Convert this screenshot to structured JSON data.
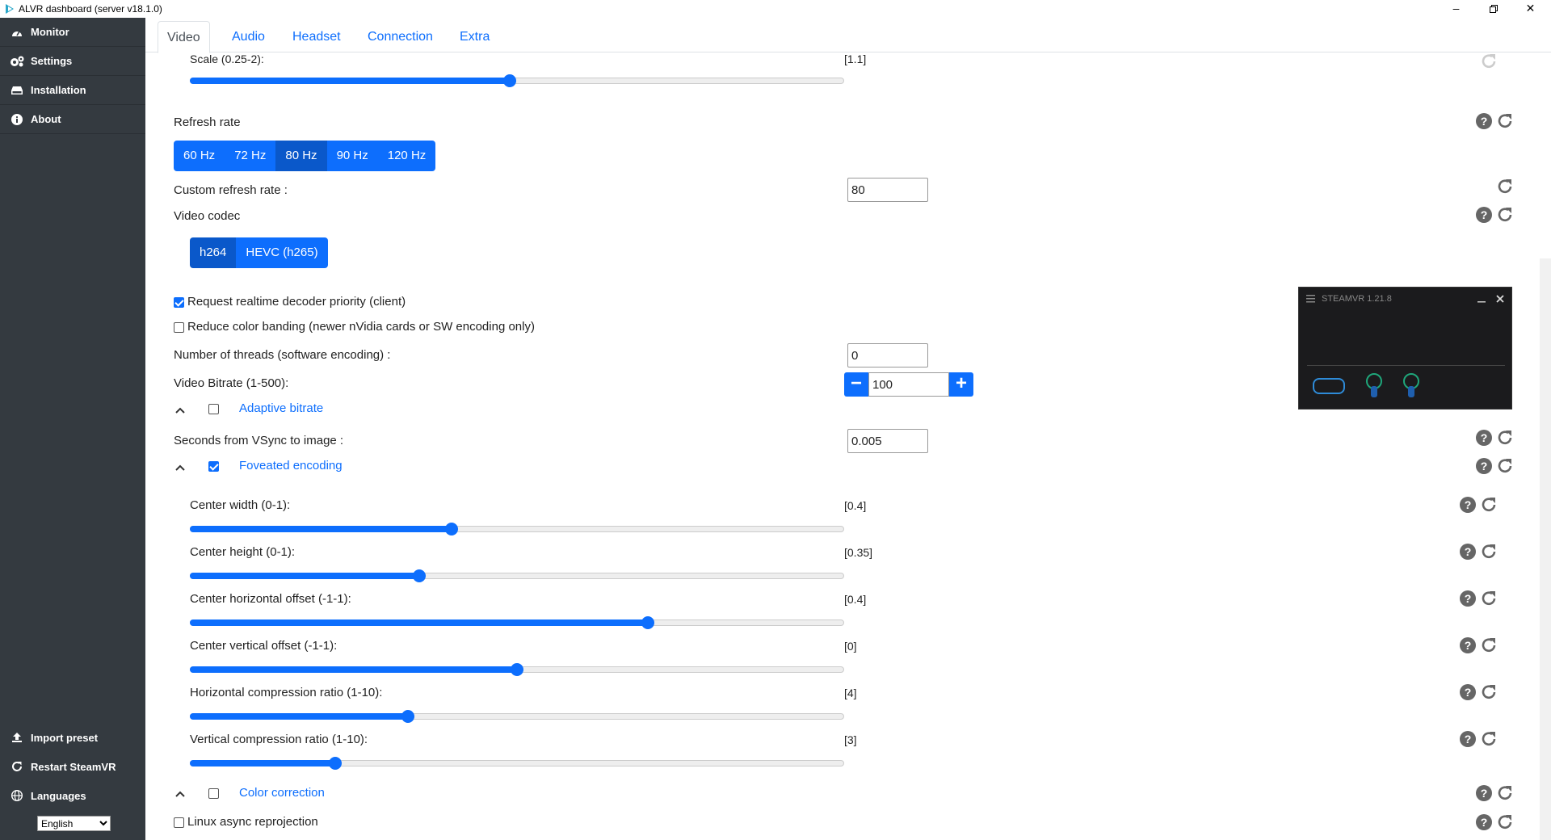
{
  "window": {
    "title": "ALVR dashboard (server v18.1.0)",
    "minimize": "–",
    "maximize": "□",
    "close": "✕"
  },
  "sidebar": {
    "items": [
      {
        "label": "Monitor",
        "icon": "dashboard-icon"
      },
      {
        "label": "Settings",
        "icon": "gears-icon"
      },
      {
        "label": "Installation",
        "icon": "hdd-icon"
      },
      {
        "label": "About",
        "icon": "info-icon"
      }
    ],
    "bottom": [
      {
        "label": "Import preset",
        "icon": "upload-icon"
      },
      {
        "label": "Restart SteamVR",
        "icon": "restart-icon"
      },
      {
        "label": "Languages",
        "icon": "globe-icon"
      }
    ],
    "language": "English"
  },
  "tabs": [
    "Video",
    "Audio",
    "Headset",
    "Connection",
    "Extra"
  ],
  "active_tab": "Video",
  "video": {
    "scale": {
      "label": "Scale (0.25-2):",
      "value": "[1.1]",
      "level": 0.489
    },
    "refresh_rate": {
      "label": "Refresh rate",
      "options": [
        "60 Hz",
        "72 Hz",
        "80 Hz",
        "90 Hz",
        "120 Hz"
      ],
      "selected": "80 Hz"
    },
    "custom_refresh_rate": {
      "label": "Custom refresh rate :",
      "value": "80"
    },
    "video_codec": {
      "label": "Video codec",
      "options": [
        "h264",
        "HEVC (h265)"
      ],
      "selected": "h264"
    },
    "realtime_decoder": {
      "label": "Request realtime decoder priority (client)",
      "checked": true
    },
    "color_banding": {
      "label": "Reduce color banding (newer nVidia cards or SW encoding only)",
      "checked": false
    },
    "threads": {
      "label": "Number of threads (software encoding) :",
      "value": "0"
    },
    "bitrate": {
      "label": "Video Bitrate (1-500):",
      "value": "100",
      "minus": "−",
      "plus": "+"
    },
    "adaptive_bitrate": {
      "label": "Adaptive bitrate",
      "checked": false
    },
    "vsync": {
      "label": "Seconds from VSync to image :",
      "value": "0.005"
    },
    "foveated": {
      "label": "Foveated encoding",
      "checked": true
    },
    "foveated_sliders": [
      {
        "label": "Center width (0-1):",
        "value": "[0.4]",
        "level": 0.4
      },
      {
        "label": "Center height (0-1):",
        "value": "[0.35]",
        "level": 0.35
      },
      {
        "label": "Center horizontal offset (-1-1):",
        "value": "[0.4]",
        "level": 0.7
      },
      {
        "label": "Center vertical offset (-1-1):",
        "value": "[0]",
        "level": 0.5
      },
      {
        "label": "Horizontal compression ratio (1-10):",
        "value": "[4]",
        "level": 0.333
      },
      {
        "label": "Vertical compression ratio (1-10):",
        "value": "[3]",
        "level": 0.222
      }
    ],
    "color_correction": {
      "label": "Color correction",
      "checked": false
    },
    "linux_async": {
      "label": "Linux async reprojection",
      "checked": false
    }
  },
  "steamvr": {
    "title": "STEAMVR 1.21.8"
  },
  "colors": {
    "accent": "#0d6efd",
    "sidebar": "#343a40"
  }
}
